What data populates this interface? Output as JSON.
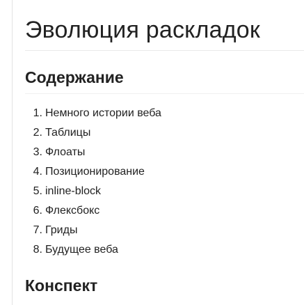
{
  "page": {
    "title": "Эволюция раскладок"
  },
  "contents": {
    "heading": "Содержание",
    "items": [
      {
        "number": "1.",
        "label": "Немного истории веба"
      },
      {
        "number": "2.",
        "label": "Таблицы"
      },
      {
        "number": "3.",
        "label": "Флоаты"
      },
      {
        "number": "4.",
        "label": "Позиционирование"
      },
      {
        "number": "5.",
        "label": "inline-block"
      },
      {
        "number": "6.",
        "label": "Флексбокс"
      },
      {
        "number": "7.",
        "label": "Гриды"
      },
      {
        "number": "8.",
        "label": "Будущее веба"
      }
    ]
  },
  "summary": {
    "heading": "Конспект"
  }
}
